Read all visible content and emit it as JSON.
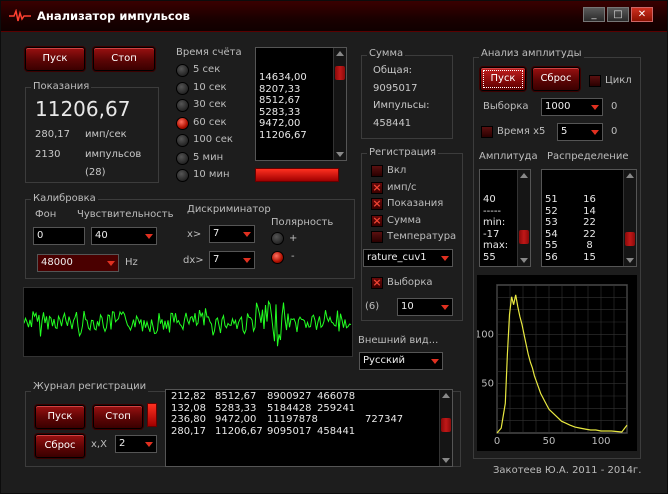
{
  "window": {
    "title": "Анализатор импульсов",
    "min_label": "_",
    "max_label": "□",
    "close_label": "✕"
  },
  "controls": {
    "start_label": "Пуск",
    "stop_label": "Стоп"
  },
  "readings": {
    "title": "Показания",
    "main_value": "11206,67",
    "rate_value": "280,17",
    "rate_unit": "имп/сек",
    "pulses_value": "2130",
    "pulses_unit": "импульсов",
    "extra": "(28)"
  },
  "count_time": {
    "title": "Время счёта",
    "options": [
      "5 сек",
      "10 сек",
      "30 сек",
      "60 сек",
      "100 сек",
      "5 мин",
      "10 мин"
    ],
    "selected_index": 3
  },
  "results_list": {
    "items": [
      "14634,00",
      "8207,33",
      "8512,67",
      "5283,33",
      "9472,00",
      "11206,67"
    ]
  },
  "sum": {
    "title": "Сумма",
    "total_label": "Общая:",
    "total_value": "9095017",
    "pulses_label": "Импульсы:",
    "pulses_value": "458441"
  },
  "registration": {
    "title": "Регистрация",
    "items": [
      {
        "label": "Вкл",
        "checked": false
      },
      {
        "label": "имп/с",
        "checked": true
      },
      {
        "label": "Показания",
        "checked": true
      },
      {
        "label": "Сумма",
        "checked": true
      },
      {
        "label": "Температура",
        "checked": false
      }
    ],
    "combo_value": "rature_cuv1",
    "sample_label": "Выборка",
    "sample_checked": true,
    "sample_prefix": "(6)",
    "sample_value": "10"
  },
  "calibration": {
    "title": "Калибровка",
    "bg_label": "Фон",
    "sens_label": "Чувствительность",
    "bg_value": "0",
    "sens_value": "40",
    "freq_value": "48000",
    "freq_unit": "Hz"
  },
  "discriminator": {
    "title": "Дискриминатор",
    "x_label": "x>",
    "x_value": "7",
    "dx_label": "dx>",
    "dx_value": "7",
    "polarity_label": "Полярность",
    "plus_label": "+",
    "minus_label": "-",
    "selected": "minus"
  },
  "appearance": {
    "title": "Внешний вид...",
    "value": "Русский"
  },
  "amplitude": {
    "title": "Анализ амплитуды",
    "start_label": "Пуск",
    "reset_label": "Сброс",
    "cycle_label": "Цикл",
    "sample_label": "Выборка",
    "sample_value": "1000",
    "sample_zero": "0",
    "time_label": "Время х5",
    "time_value": "5",
    "time_zero": "0",
    "amp_title": "Амплитуда",
    "dist_title": "Распределение",
    "amp_list": [
      "40",
      "-----",
      "min:",
      "-17",
      "max:",
      "55"
    ],
    "dist_list": [
      "51        16",
      "52        14",
      "53        22",
      "54        22",
      "55         8",
      "56        15"
    ]
  },
  "log": {
    "title": "Журнал регистрации",
    "start_label": "Пуск",
    "stop_label": "Стоп",
    "reset_label": "Сброс",
    "xx_label": "x,X",
    "xx_value": "2",
    "rows": [
      [
        "212,82",
        "8512,67",
        "8900927",
        "466078",
        ""
      ],
      [
        "132,08",
        "5283,33",
        "5184428",
        "259241",
        ""
      ],
      [
        "236,80",
        "9472,00",
        "11197878",
        "",
        "727347"
      ],
      [
        "280,17",
        "11206,67",
        "9095017",
        "458441",
        ""
      ]
    ]
  },
  "footer": {
    "text": "Закотеев Ю.А. 2011 - 2014г."
  },
  "colors": {
    "accent_red": "#c01818",
    "plot_green": "#22ff22",
    "plot_yellow": "#e8e840"
  },
  "chart_data": {
    "type": "line",
    "title": "",
    "xlabel": "",
    "ylabel": "",
    "xlim": [
      0,
      125
    ],
    "ylim": [
      0,
      150
    ],
    "xticks": [
      0,
      50,
      100
    ],
    "yticks": [
      50,
      100
    ],
    "grid": true,
    "series": [
      {
        "x": [
          0,
          4,
          8,
          10,
          12,
          14,
          16,
          18,
          20,
          22,
          24,
          26,
          28,
          30,
          32,
          34,
          36,
          38,
          40,
          42,
          44,
          46,
          48,
          50,
          54,
          58,
          62,
          66,
          70,
          75,
          80,
          85,
          90,
          95,
          100,
          110,
          120,
          125
        ],
        "y": [
          0,
          5,
          30,
          80,
          120,
          138,
          130,
          140,
          128,
          118,
          110,
          100,
          90,
          80,
          72,
          66,
          58,
          52,
          46,
          40,
          36,
          32,
          28,
          24,
          20,
          16,
          12,
          10,
          8,
          6,
          5,
          4,
          3,
          3,
          2,
          2,
          1,
          8
        ]
      }
    ]
  }
}
